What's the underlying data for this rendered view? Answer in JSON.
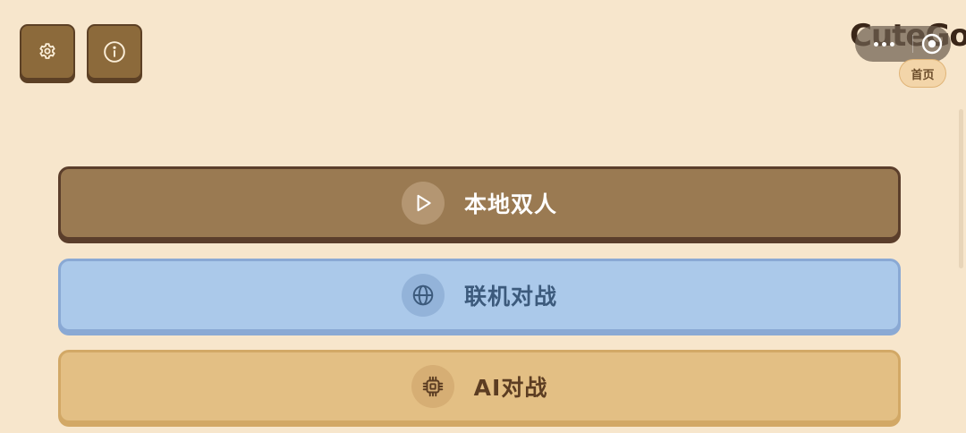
{
  "app": {
    "brand": "CuteGo",
    "home_tag": "首页"
  },
  "toolbar": {
    "settings_icon": "gear-icon",
    "info_icon": "info-icon"
  },
  "menu": {
    "items": [
      {
        "label": "本地双人",
        "icon": "play-icon"
      },
      {
        "label": "联机对战",
        "icon": "globe-icon"
      },
      {
        "label": "AI对战",
        "icon": "chip-icon"
      }
    ]
  },
  "colors": {
    "background": "#f7e6cc",
    "local_button": "#9a7a52",
    "online_button": "#abc9ea",
    "ai_button": "#e3bf84",
    "toolbar_button": "#8c6a3b"
  }
}
